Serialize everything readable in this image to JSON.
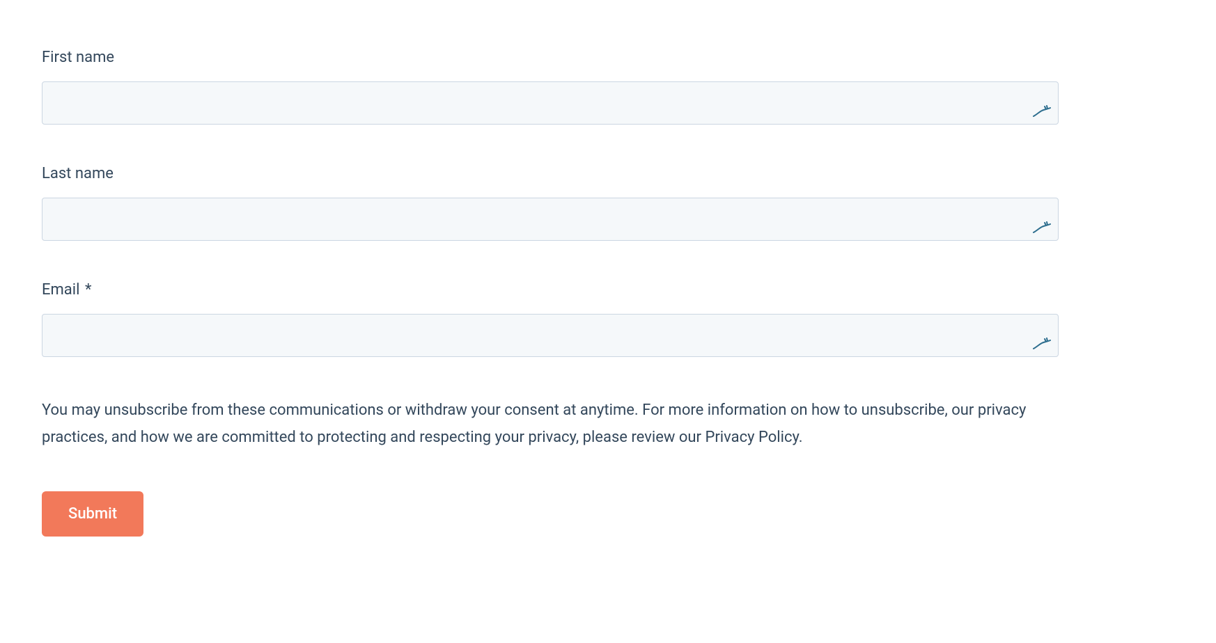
{
  "form": {
    "fields": {
      "first_name": {
        "label": "First name",
        "value": "",
        "required": false
      },
      "last_name": {
        "label": "Last name",
        "value": "",
        "required": false
      },
      "email": {
        "label": "Email",
        "value": "",
        "required": true
      }
    },
    "required_marker": "*",
    "privacy_text": "You may unsubscribe from these communications or withdraw your consent at anytime. For more information on how to unsubscribe, our privacy practices, and how we are committed to protecting and respecting your privacy, please review our Privacy Policy.",
    "submit_label": "Submit"
  },
  "icons": {
    "autofill": "gazelle-icon"
  },
  "colors": {
    "text": "#33475b",
    "input_bg": "#f5f8fa",
    "input_border": "#cbd6e2",
    "button_bg": "#f2795a",
    "button_text": "#ffffff",
    "icon_color": "#2d6e8e"
  }
}
